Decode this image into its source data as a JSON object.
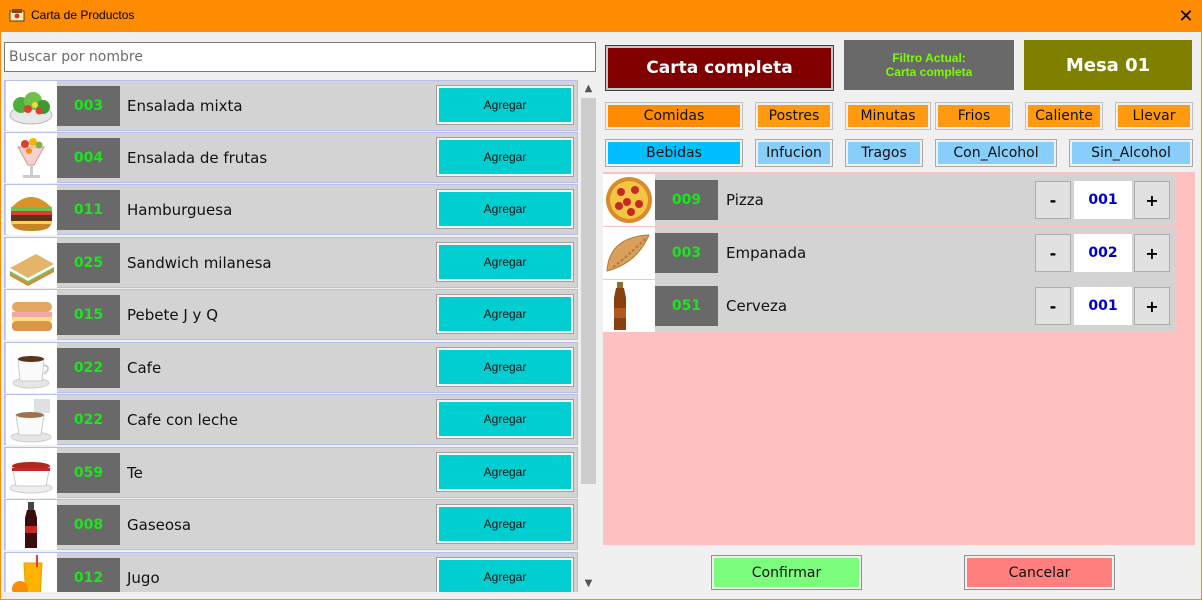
{
  "window": {
    "title": "Carta de Productos",
    "close_icon": "close-icon",
    "app_icon": "app-icon"
  },
  "search": {
    "placeholder": "Buscar por nombre",
    "value": ""
  },
  "products": [
    {
      "code": "003",
      "name": "Ensalada mixta",
      "button": "Agregar",
      "icon": "salad-icon"
    },
    {
      "code": "004",
      "name": "Ensalada de frutas",
      "button": "Agregar",
      "icon": "fruit-cup-icon"
    },
    {
      "code": "011",
      "name": "Hamburguesa",
      "button": "Agregar",
      "icon": "burger-icon"
    },
    {
      "code": "025",
      "name": "Sandwich milanesa",
      "button": "Agregar",
      "icon": "sandwich-icon"
    },
    {
      "code": "015",
      "name": "Pebete J y Q",
      "button": "Agregar",
      "icon": "pebete-icon"
    },
    {
      "code": "022",
      "name": "Cafe",
      "button": "Agregar",
      "icon": "coffee-icon"
    },
    {
      "code": "022",
      "name": "Cafe con leche",
      "button": "Agregar",
      "icon": "coffee-milk-icon"
    },
    {
      "code": "059",
      "name": "Te",
      "button": "Agregar",
      "icon": "tea-icon"
    },
    {
      "code": "008",
      "name": "Gaseosa",
      "button": "Agregar",
      "icon": "soda-bottle-icon"
    },
    {
      "code": "012",
      "name": "Jugo",
      "button": "Agregar",
      "icon": "juice-icon"
    }
  ],
  "header": {
    "carta_label": "Carta completa",
    "filtro_line1": "Filtro Actual:",
    "filtro_line2": "Carta completa",
    "mesa_label": "Mesa 01"
  },
  "categories_row1": [
    "Comidas",
    "Postres",
    "Minutas",
    "Frios",
    "Caliente",
    "Llevar"
  ],
  "categories_row2": [
    "Bebidas",
    "Infucion",
    "Tragos",
    "Con_Alcohol",
    "Sin_Alcohol"
  ],
  "order": [
    {
      "code": "009",
      "name": "Pizza",
      "qty": "001",
      "minus": "-",
      "plus": "+",
      "icon": "pizza-icon"
    },
    {
      "code": "003",
      "name": "Empanada",
      "qty": "002",
      "minus": "-",
      "plus": "+",
      "icon": "empanada-icon"
    },
    {
      "code": "051",
      "name": "Cerveza",
      "qty": "001",
      "minus": "-",
      "plus": "+",
      "icon": "beer-bottle-icon"
    }
  ],
  "footer": {
    "confirm_label": "Confirmar",
    "cancel_label": "Cancelar"
  },
  "colors": {
    "titlebar": "#ff8c00",
    "carta": "#800000",
    "mesa": "#808000",
    "code_text": "#22e022",
    "add_button": "#00ced1",
    "order_bg": "#ffc0c0",
    "confirm": "#7cfc7c",
    "cancel": "#ff7f7f"
  }
}
